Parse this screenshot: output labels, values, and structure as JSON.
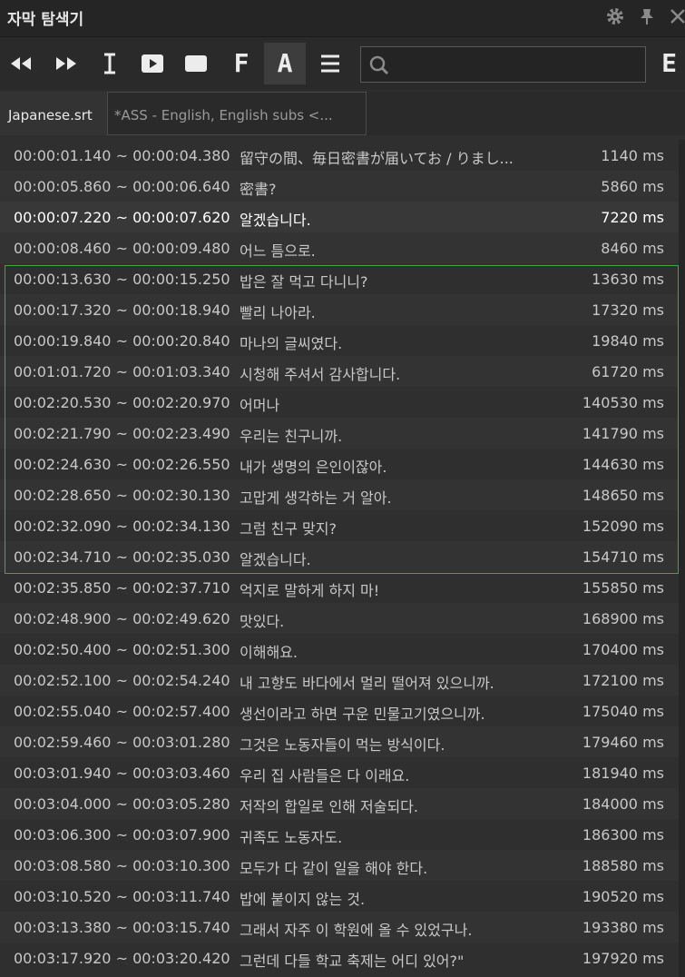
{
  "window": {
    "title": "자막 탐색기"
  },
  "toolbar": {
    "letter_f": "F",
    "letter_a": "A",
    "letter_e": "E"
  },
  "search": {
    "value": "",
    "placeholder": ""
  },
  "tabs": [
    {
      "label": "Japanese.srt",
      "active": true
    },
    {
      "label": "*ASS - English, English subs <..."
    }
  ],
  "rows": [
    {
      "time": "00:00:01.140 ~ 00:00:04.380",
      "text": "留守の間、毎日密書が届いてお / りまし...",
      "ms": "1140 ms"
    },
    {
      "time": "00:00:05.860 ~ 00:00:06.640",
      "text": "密書?",
      "ms": "5860 ms"
    },
    {
      "time": "00:00:07.220 ~ 00:00:07.620",
      "text": "알겠습니다.",
      "ms": "7220 ms"
    },
    {
      "time": "00:00:08.460 ~ 00:00:09.480",
      "text": "어느 틈으로.",
      "ms": "8460 ms"
    },
    {
      "time": "00:00:13.630 ~ 00:00:15.250",
      "text": "밥은 잘 먹고 다니니?",
      "ms": "13630 ms"
    },
    {
      "time": "00:00:17.320 ~ 00:00:18.940",
      "text": "빨리 나아라.",
      "ms": "17320 ms"
    },
    {
      "time": "00:00:19.840 ~ 00:00:20.840",
      "text": "마나의 글씨였다.",
      "ms": "19840 ms"
    },
    {
      "time": "00:01:01.720 ~ 00:01:03.340",
      "text": "시청해 주셔서 감사합니다.",
      "ms": "61720 ms"
    },
    {
      "time": "00:02:20.530 ~ 00:02:20.970",
      "text": "어머나",
      "ms": "140530 ms"
    },
    {
      "time": "00:02:21.790 ~ 00:02:23.490",
      "text": "우리는 친구니까.",
      "ms": "141790 ms"
    },
    {
      "time": "00:02:24.630 ~ 00:02:26.550",
      "text": "내가 생명의 은인이잖아.",
      "ms": "144630 ms"
    },
    {
      "time": "00:02:28.650 ~ 00:02:30.130",
      "text": "고맙게 생각하는 거 알아.",
      "ms": "148650 ms"
    },
    {
      "time": "00:02:32.090 ~ 00:02:34.130",
      "text": "그럼 친구 맞지?",
      "ms": "152090 ms"
    },
    {
      "time": "00:02:34.710 ~ 00:02:35.030",
      "text": "알겠습니다.",
      "ms": "154710 ms"
    },
    {
      "time": "00:02:35.850 ~ 00:02:37.710",
      "text": "억지로 말하게 하지 마!",
      "ms": "155850 ms"
    },
    {
      "time": "00:02:48.900 ~ 00:02:49.620",
      "text": "맛있다.",
      "ms": "168900 ms"
    },
    {
      "time": "00:02:50.400 ~ 00:02:51.300",
      "text": "이해해요.",
      "ms": "170400 ms"
    },
    {
      "time": "00:02:52.100 ~ 00:02:54.240",
      "text": "내 고향도 바다에서 멀리 떨어져 있으니까.",
      "ms": "172100 ms"
    },
    {
      "time": "00:02:55.040 ~ 00:02:57.400",
      "text": "생선이라고 하면 구운 민물고기였으니까.",
      "ms": "175040 ms"
    },
    {
      "time": "00:02:59.460 ~ 00:03:01.280",
      "text": "그것은 노동자들이 먹는 방식이다.",
      "ms": "179460 ms"
    },
    {
      "time": "00:03:01.940 ~ 00:03:03.460",
      "text": "우리 집 사람들은 다 이래요.",
      "ms": "181940 ms"
    },
    {
      "time": "00:03:04.000 ~ 00:03:05.280",
      "text": "저작의 합일로 인해 저술되다.",
      "ms": "184000 ms"
    },
    {
      "time": "00:03:06.300 ~ 00:03:07.900",
      "text": "귀족도 노동자도.",
      "ms": "186300 ms"
    },
    {
      "time": "00:03:08.580 ~ 00:03:10.300",
      "text": "모두가 다 같이 일을 해야 한다.",
      "ms": "188580 ms"
    },
    {
      "time": "00:03:10.520 ~ 00:03:11.740",
      "text": "밥에 붙이지 않는 것.",
      "ms": "190520 ms"
    },
    {
      "time": "00:03:13.380 ~ 00:03:15.740",
      "text": "그래서 자주 이 학원에 올 수 있었구나.",
      "ms": "193380 ms"
    },
    {
      "time": "00:03:17.920 ~ 00:03:20.420",
      "text": "그런데 다들 학교 축제는 어디 있어?\"",
      "ms": "197920 ms"
    }
  ]
}
